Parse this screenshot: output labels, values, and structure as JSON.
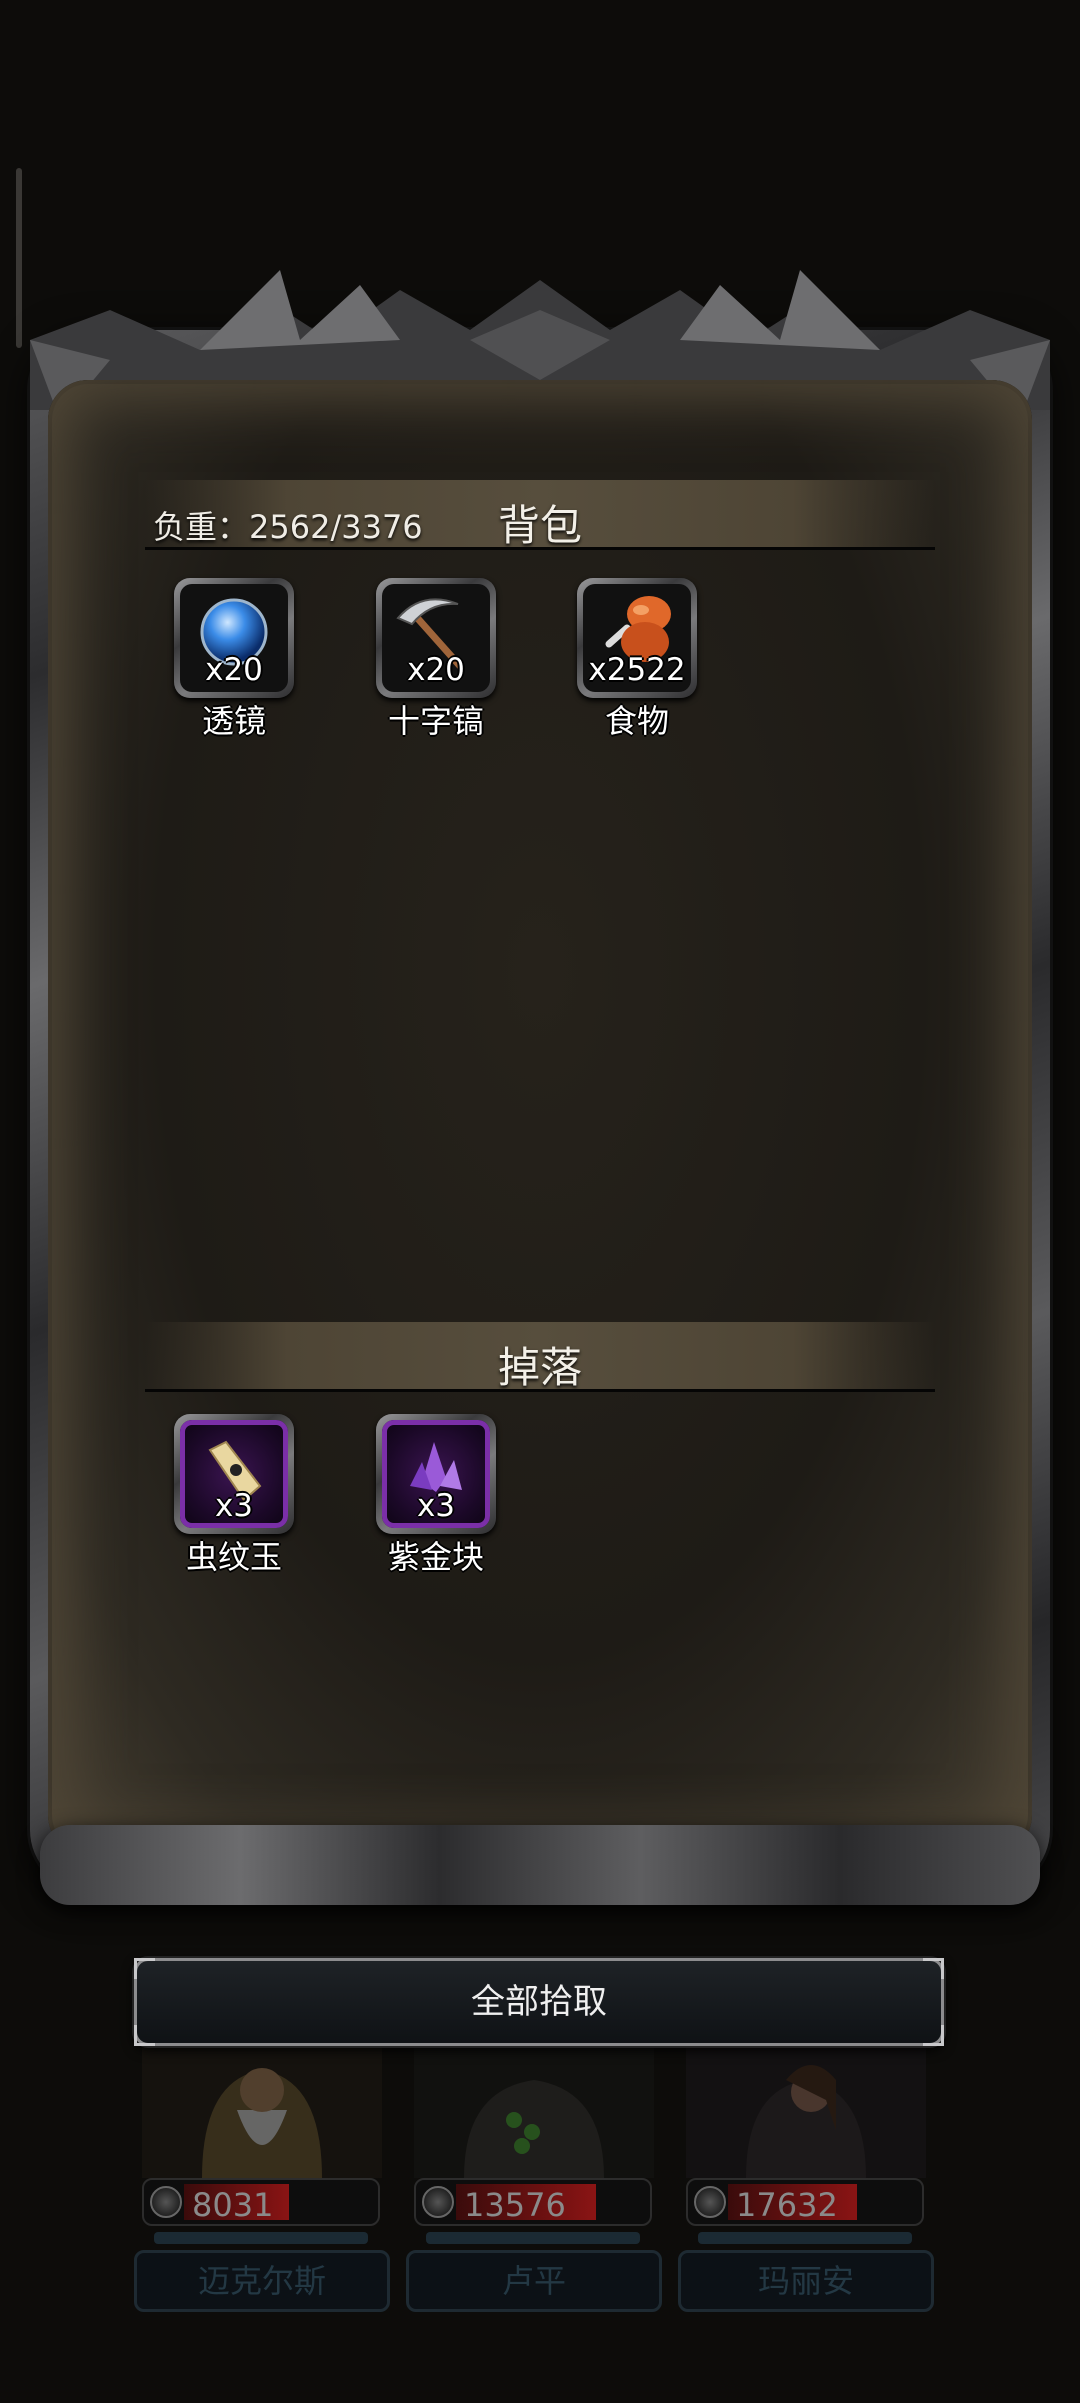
{
  "backpack": {
    "title": "背包",
    "weight_label": "负重：2562/3376",
    "items": [
      {
        "name": "透镜",
        "count": "x20",
        "icon": "lens-icon"
      },
      {
        "name": "十字镐",
        "count": "x20",
        "icon": "pickaxe-icon"
      },
      {
        "name": "食物",
        "count": "x2522",
        "icon": "food-icon"
      }
    ]
  },
  "drops": {
    "title": "掉落",
    "items": [
      {
        "name": "虫纹玉",
        "count": "x3",
        "icon": "jade-icon"
      },
      {
        "name": "紫金块",
        "count": "x3",
        "icon": "purple-gold-icon"
      }
    ]
  },
  "actions": {
    "pick_all_label": "全部拾取"
  },
  "party": [
    {
      "name": "迈克尔斯",
      "hp": "8031",
      "hp_fill": 0.45
    },
    {
      "name": "卢平",
      "hp": "13576",
      "hp_fill": 0.6
    },
    {
      "name": "玛丽安",
      "hp": "17632",
      "hp_fill": 0.55
    }
  ],
  "colors": {
    "accent_purple": "#7b2fa8",
    "hp_red": "#8a1414",
    "panel_brown": "#1e1b16"
  }
}
